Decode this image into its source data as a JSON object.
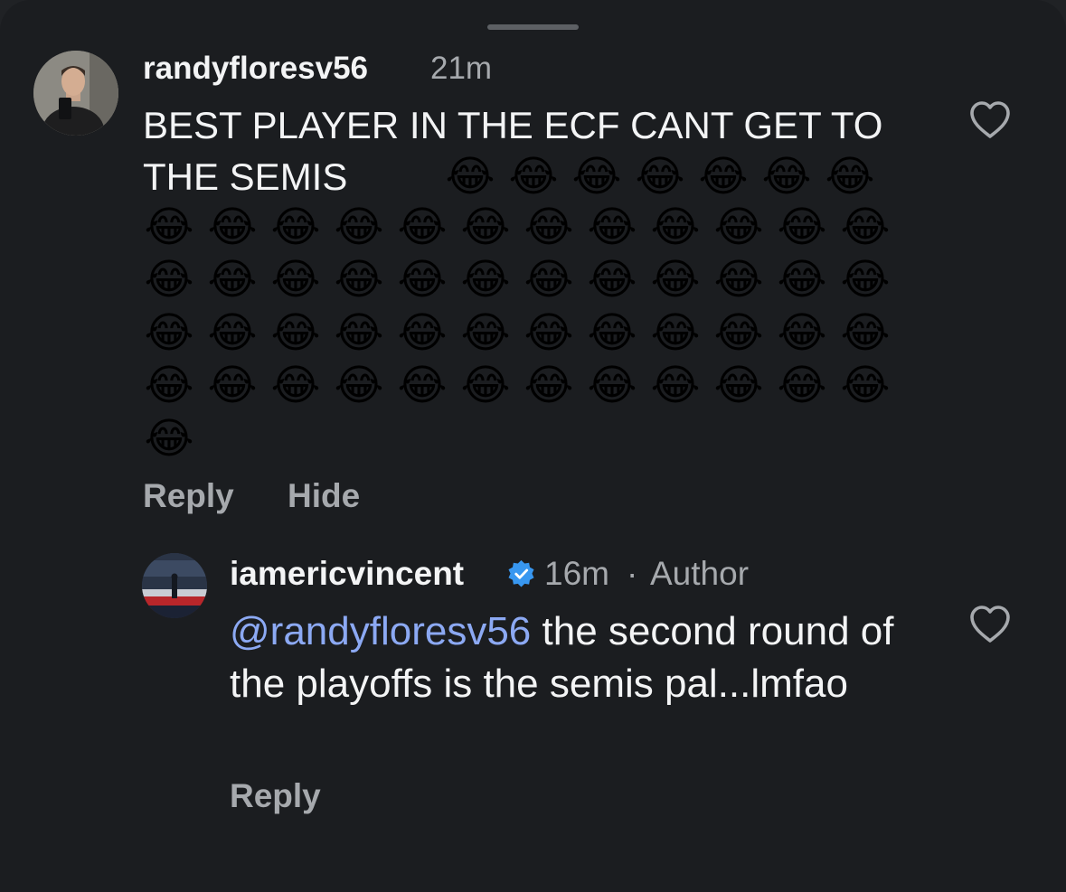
{
  "comments": [
    {
      "username": "randyfloresv56",
      "time": "21m",
      "text": "BEST PLAYER IN THE ECF CANT GET TO THE SEMIS",
      "emoji": "😂",
      "emoji_count": 56,
      "actions": {
        "reply": "Reply",
        "hide": "Hide"
      }
    },
    {
      "username": "iamericvincent",
      "time": "16m",
      "separator": "·",
      "role": "Author",
      "mention": "@randyfloresv56",
      "text": "the second round of the playoffs is the semis pal...lmfao",
      "actions": {
        "reply": "Reply"
      }
    }
  ],
  "icons": {
    "like": "heart-outline-icon",
    "verified": "verified-badge-icon"
  },
  "colors": {
    "background": "#1b1d20",
    "primary_text": "#f3f4f5",
    "secondary_text": "#a6a9ad",
    "mention": "#8ca9f3",
    "verified": "#3897f0"
  }
}
